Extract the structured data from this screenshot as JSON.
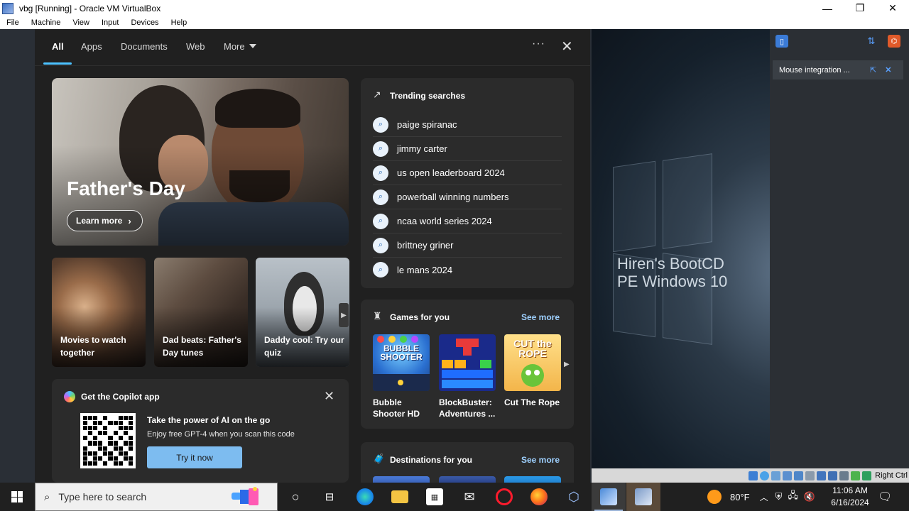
{
  "window": {
    "title": "vbg [Running] - Oracle VM VirtualBox",
    "controls": [
      "—",
      "❐",
      "✕"
    ]
  },
  "menubar": [
    "File",
    "Machine",
    "View",
    "Input",
    "Devices",
    "Help"
  ],
  "search_flyout": {
    "tabs": [
      {
        "label": "All",
        "active": true
      },
      {
        "label": "Apps"
      },
      {
        "label": "Documents"
      },
      {
        "label": "Web"
      },
      {
        "label": "More"
      }
    ],
    "more_options": "···",
    "close": "✕",
    "hero": {
      "title": "Father's Day",
      "button": "Learn more"
    },
    "cards": [
      {
        "caption": "Movies to watch together"
      },
      {
        "caption": "Dad beats: Father's Day tunes"
      },
      {
        "caption": "Daddy cool: Try our quiz"
      }
    ],
    "trending": {
      "header": "Trending searches",
      "items": [
        "paige spiranac",
        "jimmy carter",
        "us open leaderboard 2024",
        "powerball winning numbers",
        "ncaa world series 2024",
        "brittney griner",
        "le mans 2024"
      ]
    },
    "games": {
      "header": "Games for you",
      "see_more": "See more",
      "items": [
        {
          "name": "Bubble Shooter HD",
          "tile_text": "BUBBLE SHOOTER"
        },
        {
          "name": "BlockBuster: Adventures ...",
          "tile_text": ""
        },
        {
          "name": "Cut The Rope",
          "tile_text": "CUT the ROPE"
        }
      ]
    },
    "copilot": {
      "header": "Get the Copilot app",
      "headline": "Take the power of AI on the go",
      "subline": "Enjoy free GPT-4 when you scan this code",
      "button": "Try it now"
    },
    "destinations": {
      "header": "Destinations for you",
      "see_more": "See more"
    }
  },
  "guest": {
    "desktop_text_line1": "Hiren's BootCD",
    "desktop_text_line2": "PE Windows 10",
    "mouse_integration": "Mouse integration ...",
    "host_key": "Right Ctrl"
  },
  "taskbar": {
    "search_placeholder": "Type here to search",
    "weather": "80°F",
    "time": "11:06 AM",
    "date": "6/16/2024"
  },
  "colors": {
    "accent": "#4cc2ff",
    "see_more": "#9ed0ff",
    "try_button": "#7dbcf0",
    "flyout_bg": "#202020",
    "card_bg": "#2b2b2b"
  }
}
